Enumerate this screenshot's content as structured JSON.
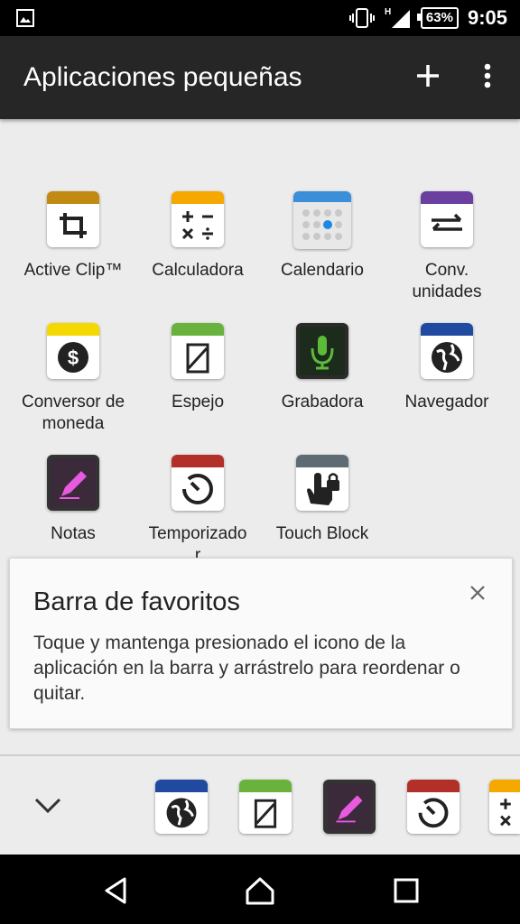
{
  "status_bar": {
    "battery": "63%",
    "time": "9:05",
    "network": "H"
  },
  "app_bar": {
    "title": "Aplicaciones pequeñas"
  },
  "apps": [
    {
      "label": "Active Clip™",
      "icon": "crop-icon",
      "band": "#c18a12"
    },
    {
      "label": "Calculadora",
      "icon": "calculator-icon",
      "band": "#f5a900"
    },
    {
      "label": "Calendario",
      "icon": "calendar-icon",
      "band": "#3a8fd8"
    },
    {
      "label": "Conv.\nunidades",
      "icon": "swap-arrows-icon",
      "band": "#6a3fa0"
    },
    {
      "label": "Conversor de\nmoneda",
      "icon": "dollar-icon",
      "band": "#f4d800"
    },
    {
      "label": "Espejo",
      "icon": "mirror-icon",
      "band": "#6ab23e"
    },
    {
      "label": "Grabadora",
      "icon": "microphone-icon",
      "band": "#2b2b2b"
    },
    {
      "label": "Navegador",
      "icon": "globe-icon",
      "band": "#1f4aa0"
    },
    {
      "label": "Notas",
      "icon": "pencil-icon",
      "band": "#333333"
    },
    {
      "label": "Temporizado\nr",
      "icon": "timer-icon",
      "band": "#b23028"
    },
    {
      "label": "Touch Block",
      "icon": "touch-lock-icon",
      "band": "#5f6b73"
    }
  ],
  "favorites_card": {
    "title": "Barra de favoritos",
    "body": "Toque y mantenga presionado el icono de la aplicación en la barra y arrástrelo para reordenar o quitar."
  },
  "dock": {
    "items": [
      "globe-icon",
      "mirror-icon",
      "pencil-icon",
      "timer-icon",
      "calculator-icon"
    ]
  }
}
